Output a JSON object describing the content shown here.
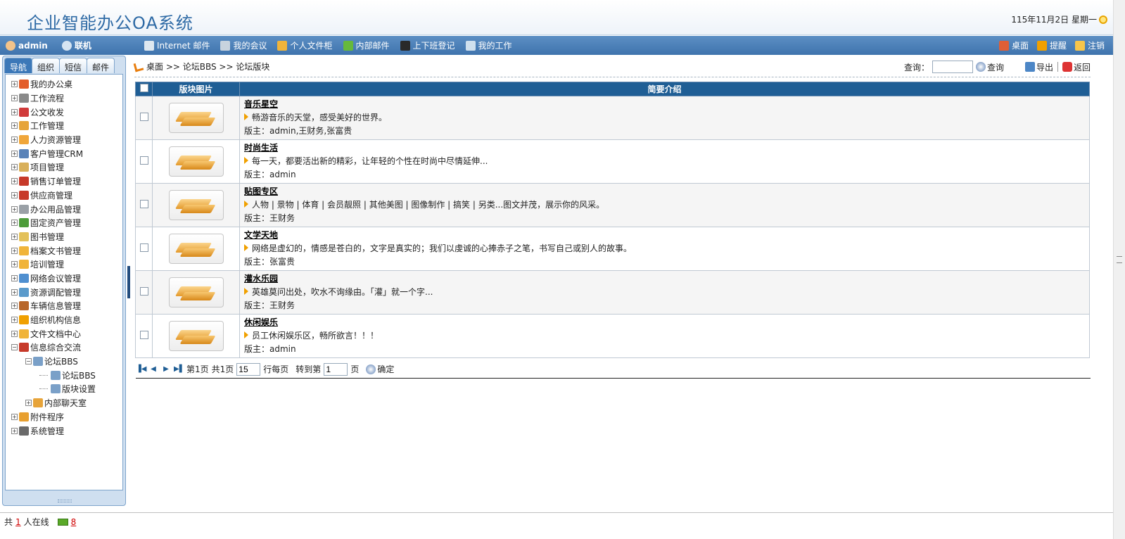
{
  "header": {
    "title": "企业智能办公OA系统",
    "date": "115年11月2日 星期一"
  },
  "toolbar": {
    "user": "admin",
    "status": "联机",
    "items": [
      {
        "label": "Internet 邮件",
        "icon": "internet-mail-icon",
        "color": "#dfe8f0"
      },
      {
        "label": "我的会议",
        "icon": "meeting-icon",
        "color": "#c8d3de"
      },
      {
        "label": "个人文件柜",
        "icon": "folder-icon",
        "color": "#f0b43a"
      },
      {
        "label": "内部邮件",
        "icon": "mail-icon",
        "color": "#66b93c"
      },
      {
        "label": "上下班登记",
        "icon": "attendance-icon",
        "color": "#2a2a2a"
      },
      {
        "label": "我的工作",
        "icon": "work-icon",
        "color": "#cfe0ee"
      }
    ],
    "right_items": [
      {
        "label": "桌面",
        "icon": "desktop-icon",
        "color": "#e05f36"
      },
      {
        "label": "提醒",
        "icon": "reminder-icon",
        "color": "#f0a000"
      },
      {
        "label": "注销",
        "icon": "logout-icon",
        "color": "#f7c54a"
      }
    ]
  },
  "sidebar": {
    "tabs": [
      "导航",
      "组织",
      "短信",
      "邮件"
    ],
    "tree": [
      {
        "label": "我的办公桌",
        "level": 1,
        "expander": "+",
        "color": "#e35d2a"
      },
      {
        "label": "工作流程",
        "level": 1,
        "expander": "+",
        "color": "#8a8a8a"
      },
      {
        "label": "公文收发",
        "level": 1,
        "expander": "+",
        "color": "#d13b3b"
      },
      {
        "label": "工作管理",
        "level": 1,
        "expander": "+",
        "color": "#e6a43a"
      },
      {
        "label": "人力资源管理",
        "level": 1,
        "expander": "+",
        "color": "#f0a63a"
      },
      {
        "label": "客户管理CRM",
        "level": 1,
        "expander": "+",
        "color": "#5a83b8"
      },
      {
        "label": "项目管理",
        "level": 1,
        "expander": "+",
        "color": "#d9b05a"
      },
      {
        "label": "销售订单管理",
        "level": 1,
        "expander": "+",
        "color": "#c73a2a"
      },
      {
        "label": "供应商管理",
        "level": 1,
        "expander": "+",
        "color": "#c73a2a"
      },
      {
        "label": "办公用品管理",
        "level": 1,
        "expander": "+",
        "color": "#9aa0a6"
      },
      {
        "label": "固定资产管理",
        "level": 1,
        "expander": "+",
        "color": "#4d9c3a"
      },
      {
        "label": "图书管理",
        "level": 1,
        "expander": "+",
        "color": "#e3c15a"
      },
      {
        "label": "档案文书管理",
        "level": 1,
        "expander": "+",
        "color": "#f0b43a"
      },
      {
        "label": "培训管理",
        "level": 1,
        "expander": "+",
        "color": "#f0b43a"
      },
      {
        "label": "网络会议管理",
        "level": 1,
        "expander": "+",
        "color": "#4f8fd0"
      },
      {
        "label": "资源调配管理",
        "level": 1,
        "expander": "+",
        "color": "#5a9acb"
      },
      {
        "label": "车辆信息管理",
        "level": 1,
        "expander": "+",
        "color": "#b8662a"
      },
      {
        "label": "组织机构信息",
        "level": 1,
        "expander": "+",
        "color": "#f0a000"
      },
      {
        "label": "文件文档中心",
        "level": 1,
        "expander": "+",
        "color": "#f0b43a"
      },
      {
        "label": "信息综合交流",
        "level": 1,
        "expander": "−",
        "color": "#c73a2a"
      },
      {
        "label": "论坛BBS",
        "level": 2,
        "expander": "−",
        "color": "#7aa0c8"
      },
      {
        "label": "论坛BBS",
        "level": 3,
        "expander": "",
        "color": "#7aa0c8"
      },
      {
        "label": "版块设置",
        "level": 3,
        "expander": "",
        "color": "#7aa0c8"
      },
      {
        "label": "内部聊天室",
        "level": 2,
        "expander": "+",
        "color": "#e7a43a"
      },
      {
        "label": "附件程序",
        "level": 1,
        "expander": "+",
        "color": "#e8a030"
      },
      {
        "label": "系统管理",
        "level": 1,
        "expander": "+",
        "color": "#6a6a6a"
      }
    ]
  },
  "main": {
    "breadcrumb": "桌面 >> 论坛BBS >> 论坛版块",
    "search_label": "查询：",
    "search_value": "",
    "search_button": "查询",
    "export_button": "导出",
    "back_button": "返回",
    "table": {
      "headers": [
        "",
        "版块图片",
        "简要介绍"
      ],
      "rows": [
        {
          "name": "音乐星空",
          "desc": "畅游音乐的天堂，感受美好的世界。",
          "mod": "版主：admin,王财务,张富贵"
        },
        {
          "name": "时尚生活",
          "desc": "每一天，都要活出新的精彩，让年轻的个性在时尚中尽情延伸...",
          "mod": "版主：admin"
        },
        {
          "name": "贴图专区",
          "desc": "人物 | 景物 | 体育 | 会员靓照 | 其他美图 | 图像制作 | 搞笑 | 另类...图文并茂，展示你的风采。",
          "mod": "版主：王财务"
        },
        {
          "name": "文学天地",
          "desc": "网络是虚幻的，情感是苍白的，文字是真实的；我们以虔诚的心捧赤子之笔，书写自己或别人的故事。",
          "mod": "版主：张富贵"
        },
        {
          "name": "灌水乐园",
          "desc": "英雄莫问出处，吹水不询缘由。「灌」就一个字...",
          "mod": "版主：王财务"
        },
        {
          "name": "休闲娱乐",
          "desc": "员工休闲娱乐区，畅所欲言！！！",
          "mod": "版主：admin"
        }
      ]
    },
    "pager": {
      "page_text": "第1页",
      "total_text": "共1页",
      "per_page_value": "15",
      "per_page_label": "行每页",
      "goto_label": "转到第",
      "goto_value": "1",
      "goto_suffix": "页",
      "confirm": "确定"
    }
  },
  "status": {
    "prefix": "共",
    "online_count": "1",
    "suffix": "人在线",
    "mail_count": "8"
  }
}
